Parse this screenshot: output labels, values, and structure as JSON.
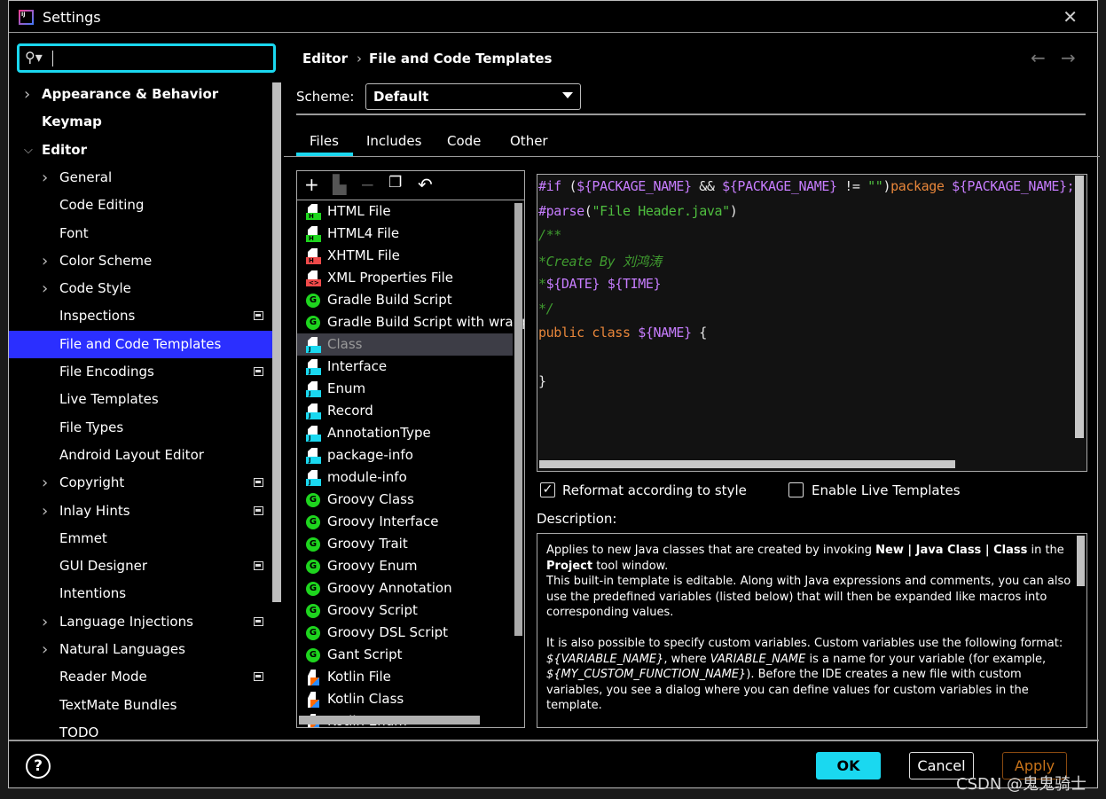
{
  "window": {
    "title": "Settings",
    "close_icon": "close-icon"
  },
  "search": {
    "value": "",
    "placeholder": ""
  },
  "breadcrumb": {
    "parent": "Editor",
    "separator": "›",
    "current": "File and Code Templates"
  },
  "sidebar": {
    "items": [
      {
        "label": "Appearance & Behavior",
        "level": 0,
        "expand": "collapsed",
        "bold": true
      },
      {
        "label": "Keymap",
        "level": 0,
        "expand": "none",
        "bold": true
      },
      {
        "label": "Editor",
        "level": 0,
        "expand": "expanded",
        "bold": true
      },
      {
        "label": "General",
        "level": 1,
        "expand": "collapsed"
      },
      {
        "label": "Code Editing",
        "level": 1,
        "expand": "none"
      },
      {
        "label": "Font",
        "level": 1,
        "expand": "none"
      },
      {
        "label": "Color Scheme",
        "level": 1,
        "expand": "collapsed"
      },
      {
        "label": "Code Style",
        "level": 1,
        "expand": "collapsed"
      },
      {
        "label": "Inspections",
        "level": 1,
        "expand": "none",
        "badge": true
      },
      {
        "label": "File and Code Templates",
        "level": 1,
        "expand": "none",
        "selected": true
      },
      {
        "label": "File Encodings",
        "level": 1,
        "expand": "none",
        "badge": true
      },
      {
        "label": "Live Templates",
        "level": 1,
        "expand": "none"
      },
      {
        "label": "File Types",
        "level": 1,
        "expand": "none"
      },
      {
        "label": "Android Layout Editor",
        "level": 1,
        "expand": "none"
      },
      {
        "label": "Copyright",
        "level": 1,
        "expand": "collapsed",
        "badge": true
      },
      {
        "label": "Inlay Hints",
        "level": 1,
        "expand": "collapsed",
        "badge": true
      },
      {
        "label": "Emmet",
        "level": 1,
        "expand": "none"
      },
      {
        "label": "GUI Designer",
        "level": 1,
        "expand": "none",
        "badge": true
      },
      {
        "label": "Intentions",
        "level": 1,
        "expand": "none"
      },
      {
        "label": "Language Injections",
        "level": 1,
        "expand": "collapsed",
        "badge": true
      },
      {
        "label": "Natural Languages",
        "level": 1,
        "expand": "collapsed"
      },
      {
        "label": "Reader Mode",
        "level": 1,
        "expand": "none",
        "badge": true
      },
      {
        "label": "TextMate Bundles",
        "level": 1,
        "expand": "none"
      },
      {
        "label": "TODO",
        "level": 1,
        "expand": "none"
      }
    ]
  },
  "scheme": {
    "label": "Scheme:",
    "value": "Default"
  },
  "tabs": [
    {
      "label": "Files",
      "active": true
    },
    {
      "label": "Includes"
    },
    {
      "label": "Code"
    },
    {
      "label": "Other"
    }
  ],
  "toolbar": [
    "plus-icon",
    "copy-template-icon",
    "minus-icon",
    "duplicate-icon",
    "reset-icon"
  ],
  "files": [
    {
      "label": "HTML File",
      "icon": "html"
    },
    {
      "label": "HTML4 File",
      "icon": "html"
    },
    {
      "label": "XHTML File",
      "icon": "xhtml"
    },
    {
      "label": "XML Properties File",
      "icon": "xml"
    },
    {
      "label": "Gradle Build Script",
      "icon": "gradle"
    },
    {
      "label": "Gradle Build Script with wrapper",
      "icon": "gradle"
    },
    {
      "label": "Class",
      "icon": "java",
      "selected": true
    },
    {
      "label": "Interface",
      "icon": "java"
    },
    {
      "label": "Enum",
      "icon": "java"
    },
    {
      "label": "Record",
      "icon": "java"
    },
    {
      "label": "AnnotationType",
      "icon": "java"
    },
    {
      "label": "package-info",
      "icon": "java"
    },
    {
      "label": "module-info",
      "icon": "java"
    },
    {
      "label": "Groovy Class",
      "icon": "groovy"
    },
    {
      "label": "Groovy Interface",
      "icon": "groovy"
    },
    {
      "label": "Groovy Trait",
      "icon": "groovy"
    },
    {
      "label": "Groovy Enum",
      "icon": "groovy"
    },
    {
      "label": "Groovy Annotation",
      "icon": "groovy"
    },
    {
      "label": "Groovy Script",
      "icon": "groovy"
    },
    {
      "label": "Groovy DSL Script",
      "icon": "groovy"
    },
    {
      "label": "Gant Script",
      "icon": "groovy"
    },
    {
      "label": "Kotlin File",
      "icon": "kotlin"
    },
    {
      "label": "Kotlin Class",
      "icon": "kotlin"
    },
    {
      "label": "Kotlin Enum",
      "icon": "kotlin"
    }
  ],
  "colors": {
    "accent": "#1ad8f0",
    "selection": "#2b2fff",
    "directive": "#c77dff",
    "variable": "#c77dff",
    "keyword": "#e8863a",
    "string": "#4fbf3f",
    "comment": "#3f9a2f",
    "plain": "#e8e8e8",
    "apply": "#c8731a"
  },
  "code": [
    [
      [
        "#if",
        "directive"
      ],
      [
        " (",
        "plain"
      ],
      [
        "${PACKAGE_NAME}",
        "variable"
      ],
      [
        " && ",
        "plain"
      ],
      [
        "${PACKAGE_NAME}",
        "variable"
      ],
      [
        " != ",
        "plain"
      ],
      [
        "\"\"",
        "string"
      ],
      [
        ")",
        "plain"
      ],
      [
        "package ",
        "keyword"
      ],
      [
        "${PACKAGE_NAME};",
        "variable"
      ]
    ],
    [
      [
        "#parse",
        "directive"
      ],
      [
        "(",
        "plain"
      ],
      [
        "\"File Header.java\"",
        "string"
      ],
      [
        ")",
        "plain"
      ]
    ],
    [
      [
        "/**",
        "comment"
      ]
    ],
    [
      [
        "*Create By 刘鸿涛",
        "comment"
      ]
    ],
    [
      [
        "*",
        "comment"
      ],
      [
        "${DATE}",
        "variable"
      ],
      [
        " ",
        "plain"
      ],
      [
        "${TIME}",
        "variable"
      ]
    ],
    [
      [
        "*/",
        "comment"
      ]
    ],
    [
      [
        "public class ",
        "keyword"
      ],
      [
        "${NAME}",
        "variable"
      ],
      [
        " {",
        "plain"
      ]
    ],
    [],
    [
      [
        "}",
        "plain"
      ]
    ]
  ],
  "options": {
    "reformat": {
      "label": "Reformat according to style",
      "checked": true
    },
    "live": {
      "label": "Enable Live Templates",
      "checked": false
    }
  },
  "description": {
    "label": "Description:",
    "p1": [
      [
        "Applies to new Java classes that are created by invoking ",
        ""
      ],
      [
        "New | Java Class | Class",
        "b"
      ],
      [
        " in the ",
        ""
      ],
      [
        "Project",
        "b"
      ],
      [
        " tool window.",
        ""
      ]
    ],
    "p2": "This built-in template is editable. Along with Java expressions and comments, you can also use the predefined variables (listed below) that will then be expanded like macros into corresponding values.",
    "p3": [
      [
        "It is also possible to specify custom variables. Custom variables use the following format: ",
        ""
      ],
      [
        "${VARIABLE_NAME}",
        "i"
      ],
      [
        ", where ",
        ""
      ],
      [
        "VARIABLE_NAME",
        "i"
      ],
      [
        " is a name for your variable (for example, ",
        ""
      ],
      [
        "${MY_CUSTOM_FUNCTION_NAME}",
        "i"
      ],
      [
        "). Before the IDE creates a new file with custom variables, you see a dialog where you can define values for custom variables in the template.",
        ""
      ]
    ]
  },
  "buttons": {
    "ok": "OK",
    "cancel": "Cancel",
    "apply": "Apply",
    "help": "?"
  },
  "watermark": "CSDN @鬼鬼骑士"
}
